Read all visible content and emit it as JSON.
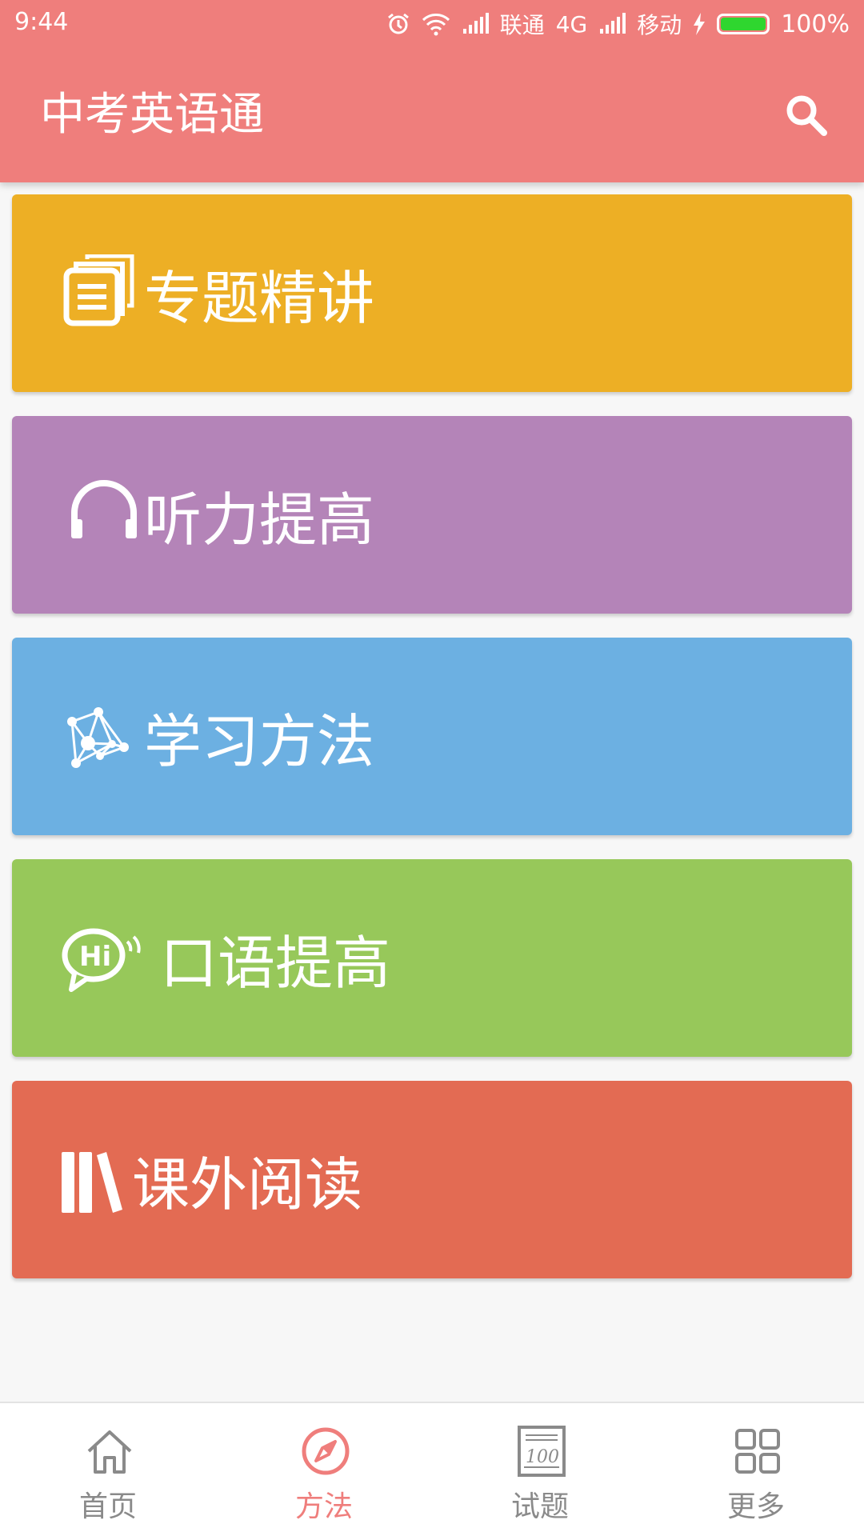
{
  "status_bar": {
    "time": "9:44",
    "carrier1": "联通",
    "network": "4G",
    "carrier2": "移动",
    "battery": "100%"
  },
  "app_bar": {
    "title": "中考英语通",
    "search_icon": "search-icon",
    "color": "#ef7e7c"
  },
  "cards": [
    {
      "label": "专题精讲",
      "icon": "documents-icon",
      "color": "#edaf25"
    },
    {
      "label": "听力提高",
      "icon": "headphones-icon",
      "color": "#b484b8"
    },
    {
      "label": "学习方法",
      "icon": "network-graph-icon",
      "color": "#6cb0e2"
    },
    {
      "label": "口语提高",
      "icon": "hi-speech-bubble-icon",
      "color": "#97c85a"
    },
    {
      "label": "课外阅读",
      "icon": "books-icon",
      "color": "#e36b53"
    }
  ],
  "bottom_nav": {
    "items": [
      {
        "label": "首页",
        "icon": "home-icon"
      },
      {
        "label": "方法",
        "icon": "compass-icon"
      },
      {
        "label": "试题",
        "icon": "exam-paper-icon"
      },
      {
        "label": "更多",
        "icon": "grid-icon"
      }
    ],
    "active": "方法",
    "active_color": "#ef7e7c",
    "inactive_color": "#8a8a8a"
  }
}
